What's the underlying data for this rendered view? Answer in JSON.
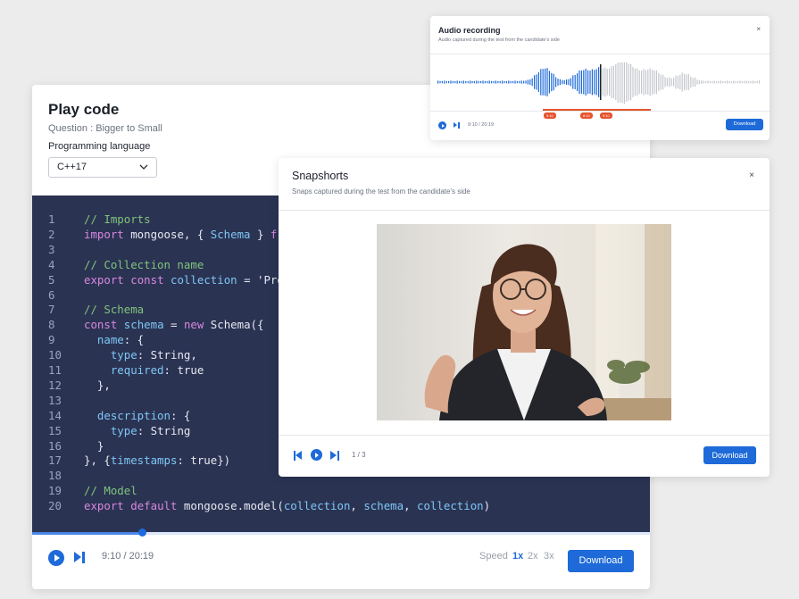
{
  "play_code": {
    "title": "Play code",
    "question": "Question : Bigger to Small",
    "language_label": "Programming language",
    "language_value": "C++17",
    "code_lines": [
      {
        "n": "1",
        "tokens": [
          {
            "t": "// Imports",
            "c": "com"
          }
        ]
      },
      {
        "n": "2",
        "tokens": [
          {
            "t": "import",
            "c": "kw"
          },
          {
            "t": " mongoose, { ",
            "c": "plain"
          },
          {
            "t": "Schema",
            "c": "id"
          },
          {
            "t": " } ",
            "c": "plain"
          },
          {
            "t": "fr",
            "c": "kw"
          }
        ]
      },
      {
        "n": "3",
        "tokens": []
      },
      {
        "n": "4",
        "tokens": [
          {
            "t": "// Collection name",
            "c": "com"
          }
        ]
      },
      {
        "n": "5",
        "tokens": [
          {
            "t": "export",
            "c": "kw"
          },
          {
            "t": " ",
            "c": "plain"
          },
          {
            "t": "const",
            "c": "kw"
          },
          {
            "t": " ",
            "c": "plain"
          },
          {
            "t": "collection",
            "c": "id"
          },
          {
            "t": " = 'Pro",
            "c": "plain"
          }
        ]
      },
      {
        "n": "6",
        "tokens": []
      },
      {
        "n": "7",
        "tokens": [
          {
            "t": "// Schema",
            "c": "com"
          }
        ]
      },
      {
        "n": "8",
        "tokens": [
          {
            "t": "const",
            "c": "kw"
          },
          {
            "t": " ",
            "c": "plain"
          },
          {
            "t": "schema",
            "c": "id"
          },
          {
            "t": " = ",
            "c": "plain"
          },
          {
            "t": "new",
            "c": "kw"
          },
          {
            "t": " Schema({",
            "c": "plain"
          }
        ]
      },
      {
        "n": "9",
        "tokens": [
          {
            "t": "  ",
            "c": "plain"
          },
          {
            "t": "name",
            "c": "id"
          },
          {
            "t": ": {",
            "c": "plain"
          }
        ]
      },
      {
        "n": "10",
        "tokens": [
          {
            "t": "    ",
            "c": "plain"
          },
          {
            "t": "type",
            "c": "id"
          },
          {
            "t": ": String,",
            "c": "plain"
          }
        ]
      },
      {
        "n": "11",
        "tokens": [
          {
            "t": "    ",
            "c": "plain"
          },
          {
            "t": "required",
            "c": "id"
          },
          {
            "t": ": true",
            "c": "plain"
          }
        ]
      },
      {
        "n": "12",
        "tokens": [
          {
            "t": "  },",
            "c": "plain"
          }
        ]
      },
      {
        "n": "13",
        "tokens": []
      },
      {
        "n": "14",
        "tokens": [
          {
            "t": "  ",
            "c": "plain"
          },
          {
            "t": "description",
            "c": "id"
          },
          {
            "t": ": {",
            "c": "plain"
          }
        ]
      },
      {
        "n": "15",
        "tokens": [
          {
            "t": "    ",
            "c": "plain"
          },
          {
            "t": "type",
            "c": "id"
          },
          {
            "t": ": String",
            "c": "plain"
          }
        ]
      },
      {
        "n": "16",
        "tokens": [
          {
            "t": "  }",
            "c": "plain"
          }
        ]
      },
      {
        "n": "17",
        "tokens": [
          {
            "t": "}, {",
            "c": "plain"
          },
          {
            "t": "timestamps",
            "c": "id"
          },
          {
            "t": ": true})",
            "c": "plain"
          }
        ]
      },
      {
        "n": "18",
        "tokens": []
      },
      {
        "n": "19",
        "tokens": [
          {
            "t": "// Model",
            "c": "com"
          }
        ]
      },
      {
        "n": "20",
        "tokens": [
          {
            "t": "export",
            "c": "kw"
          },
          {
            "t": " ",
            "c": "plain"
          },
          {
            "t": "default",
            "c": "kw"
          },
          {
            "t": " mongoose.model(",
            "c": "plain"
          },
          {
            "t": "collection",
            "c": "id"
          },
          {
            "t": ", ",
            "c": "plain"
          },
          {
            "t": "schema",
            "c": "id"
          },
          {
            "t": ", ",
            "c": "plain"
          },
          {
            "t": "collection",
            "c": "id"
          },
          {
            "t": ")",
            "c": "plain"
          }
        ]
      }
    ],
    "progress": 0.178,
    "time": "9:10 / 20:19",
    "speed_label": "Speed",
    "speeds": [
      "1x",
      "2x",
      "3x"
    ],
    "active_speed": "1x",
    "download_label": "Download"
  },
  "audio": {
    "title": "Audio recording",
    "subtitle": "Audio captured during the test from the candidate's side",
    "close": "×",
    "markers": [
      "5:10",
      "8:10",
      "9:10"
    ],
    "time": "9:10 / 20:19",
    "download_label": "Download",
    "progress": 0.5
  },
  "snapshots": {
    "title": "Snapshorts",
    "subtitle": "Snaps captured during the test from the candidate's side",
    "close": "×",
    "counter": "1 / 3",
    "download_label": "Download"
  },
  "colors": {
    "accent": "#1e6ad8",
    "code_bg": "#2b3353",
    "marker": "#e5532d"
  }
}
